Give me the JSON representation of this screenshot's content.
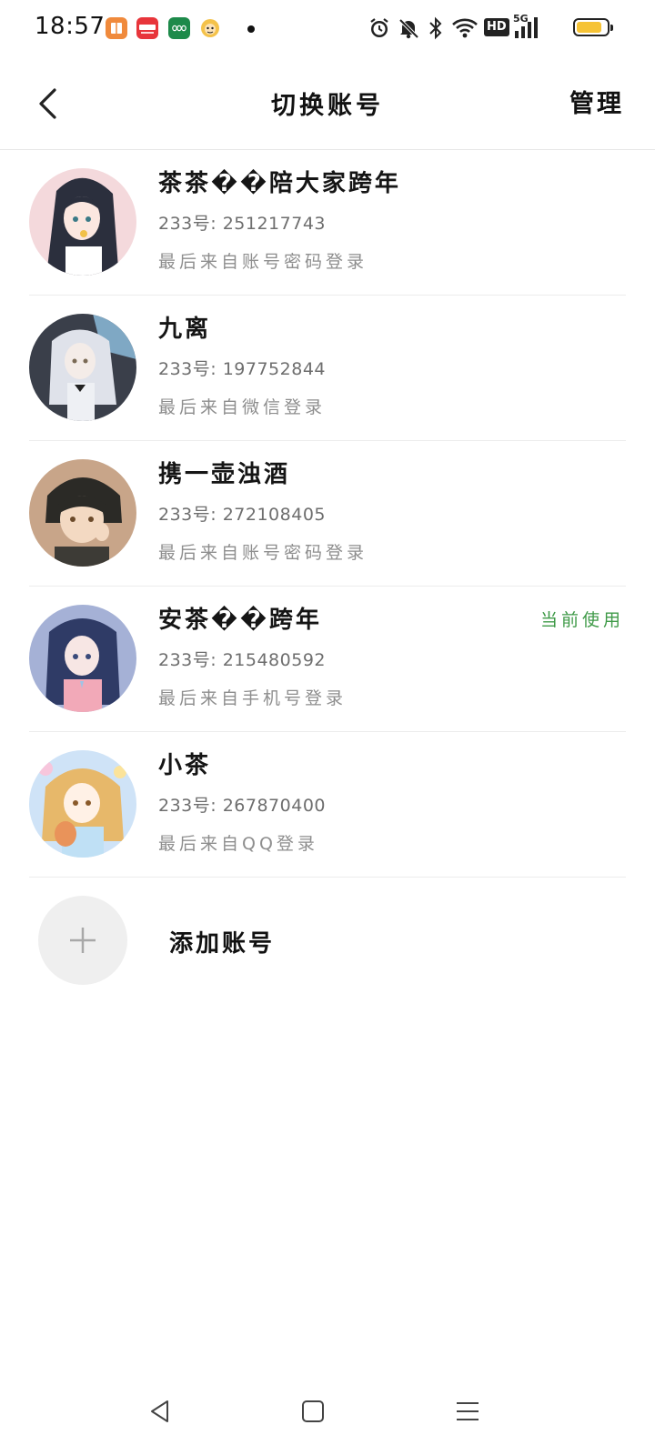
{
  "status_bar": {
    "time": "18:57",
    "app_icons": [
      {
        "name": "books-app-icon",
        "color": "#f08a3c"
      },
      {
        "name": "red-shop-app-icon",
        "color": "#e8353b",
        "text": "小红书"
      },
      {
        "name": "oppo-app-icon",
        "color": "#1d8a4a",
        "text": "oppo"
      },
      {
        "name": "monkey-app-icon",
        "color": "#f4c24a"
      }
    ],
    "signal_label": "5G",
    "hd_label": "HD",
    "battery_color": "#f6c335"
  },
  "nav": {
    "title": "切换账号",
    "manage_label": "管理"
  },
  "accounts": [
    {
      "name": "茶茶��陪大家跨年",
      "id_line": "233号: 251217743",
      "login_method": "最后来自账号密码登录",
      "current": "",
      "avatar_colors": [
        "#f4d9dc",
        "#2b2f3d"
      ]
    },
    {
      "name": "九离",
      "id_line": "233号: 197752844",
      "login_method": "最后来自微信登录",
      "current": "",
      "avatar_colors": [
        "#c9ced6",
        "#3a3f4a"
      ]
    },
    {
      "name": "携一壶浊酒",
      "id_line": "233号: 272108405",
      "login_method": "最后来自账号密码登录",
      "current": "",
      "avatar_colors": [
        "#c8a589",
        "#2b2a26"
      ]
    },
    {
      "name": "安茶��跨年",
      "id_line": "233号: 215480592",
      "login_method": "最后来自手机号登录",
      "current": "当前使用",
      "avatar_colors": [
        "#a5b1d6",
        "#2f3b66"
      ]
    },
    {
      "name": "小茶",
      "id_line": "233号: 267870400",
      "login_method": "最后来自QQ登录",
      "current": "",
      "avatar_colors": [
        "#cfe3f7",
        "#e7b86a"
      ]
    }
  ],
  "add_account": {
    "label": "添加账号"
  },
  "accent_green": "#3f9a48"
}
